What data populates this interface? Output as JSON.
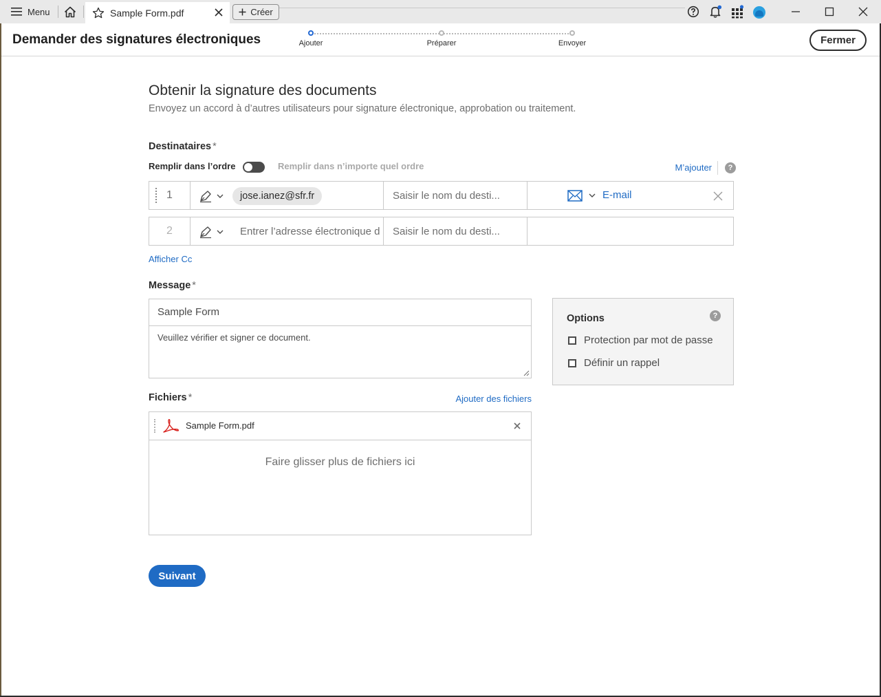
{
  "tabbar": {
    "menu_label": "Menu",
    "tab_title": "Sample Form.pdf",
    "create_label": "Créer"
  },
  "header": {
    "title": "Demander des signatures électroniques",
    "steps": [
      {
        "label": "Ajouter",
        "active": true
      },
      {
        "label": "Préparer",
        "active": false
      },
      {
        "label": "Envoyer",
        "active": false
      }
    ],
    "close_label": "Fermer"
  },
  "main": {
    "title": "Obtenir la signature des documents",
    "subtitle": "Envoyez un accord à d’autres utilisateurs pour signature électronique, approbation ou traitement.",
    "recipients": {
      "label": "Destinataires",
      "required_mark": "*",
      "order_label": "Remplir dans l’ordre",
      "any_order_label": "Remplir dans n’importe quel ordre",
      "add_me_label": "M’ajouter",
      "help_glyph": "?",
      "rows": [
        {
          "number": "1",
          "email": "jose.ianez@sfr.fr",
          "name_placeholder": "Saisir le nom du desti...",
          "method": "E-mail"
        },
        {
          "number": "2",
          "email_placeholder": "Entrer l’adresse électronique d",
          "name_placeholder": "Saisir le nom du desti..."
        }
      ],
      "show_cc_label": "Afficher Cc"
    },
    "message": {
      "label": "Message",
      "required_mark": "*",
      "subject": "Sample Form",
      "body": "Veuillez vérifier et signer ce document."
    },
    "options": {
      "title": "Options",
      "help_glyph": "?",
      "items": [
        "Protection par mot de passe",
        "Définir un rappel"
      ]
    },
    "files": {
      "label": "Fichiers",
      "required_mark": "*",
      "add_label": "Ajouter des fichiers",
      "items": [
        {
          "name": "Sample Form.pdf"
        }
      ],
      "drop_text": "Faire glisser plus de fichiers ici"
    },
    "next_label": "Suivant"
  },
  "colors": {
    "accent": "#1f6bc4",
    "step_active": "#2268d2",
    "avatar": "#2aa0e0",
    "pdf_red": "#d8231f"
  }
}
